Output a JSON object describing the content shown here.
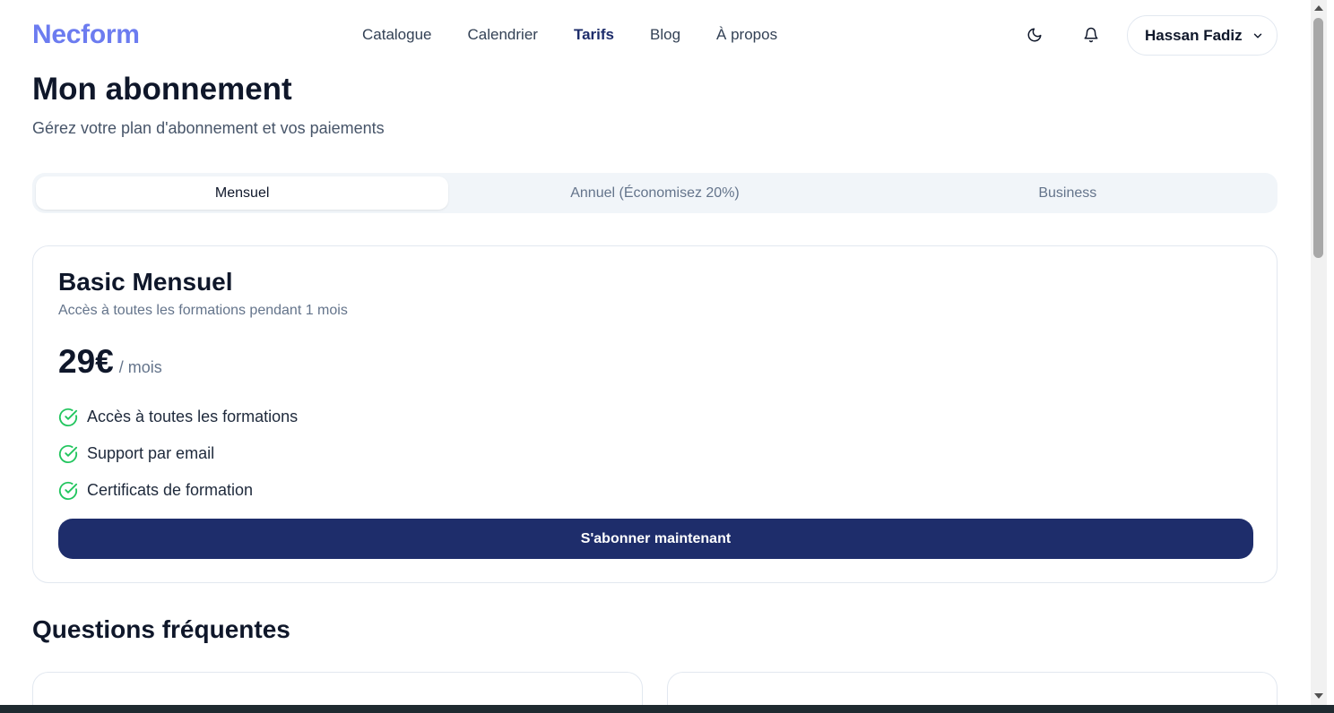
{
  "header": {
    "logo": "Necform",
    "nav": [
      {
        "label": "Catalogue"
      },
      {
        "label": "Calendrier"
      },
      {
        "label": "Tarifs"
      },
      {
        "label": "Blog"
      },
      {
        "label": "À propos"
      }
    ],
    "active_nav": "Tarifs",
    "user_name": "Hassan Fadiz",
    "icons": [
      "moon-icon",
      "bell-icon",
      "chevron-down-icon"
    ]
  },
  "page": {
    "title": "Mon abonnement",
    "subtitle": "Gérez votre plan d'abonnement et vos paiements"
  },
  "tabs": [
    {
      "label": "Mensuel"
    },
    {
      "label": "Annuel (Économisez 20%)"
    },
    {
      "label": "Business"
    }
  ],
  "active_tab": "Mensuel",
  "plan": {
    "name": "Basic Mensuel",
    "description": "Accès à toutes les formations pendant 1 mois",
    "price": "29€",
    "period": "/ mois",
    "features": [
      {
        "label": "Accès à toutes les formations"
      },
      {
        "label": "Support par email"
      },
      {
        "label": "Certificats de formation"
      }
    ],
    "cta": "S'abonner maintenant"
  },
  "faq": {
    "title": "Questions fréquentes",
    "questions": [
      {
        "q": ""
      },
      {
        "q": ""
      }
    ]
  },
  "colors": {
    "logo": "#6c7cf0",
    "primary": "#1e2d6b",
    "check": "#22c55e",
    "muted": "#64748b"
  }
}
